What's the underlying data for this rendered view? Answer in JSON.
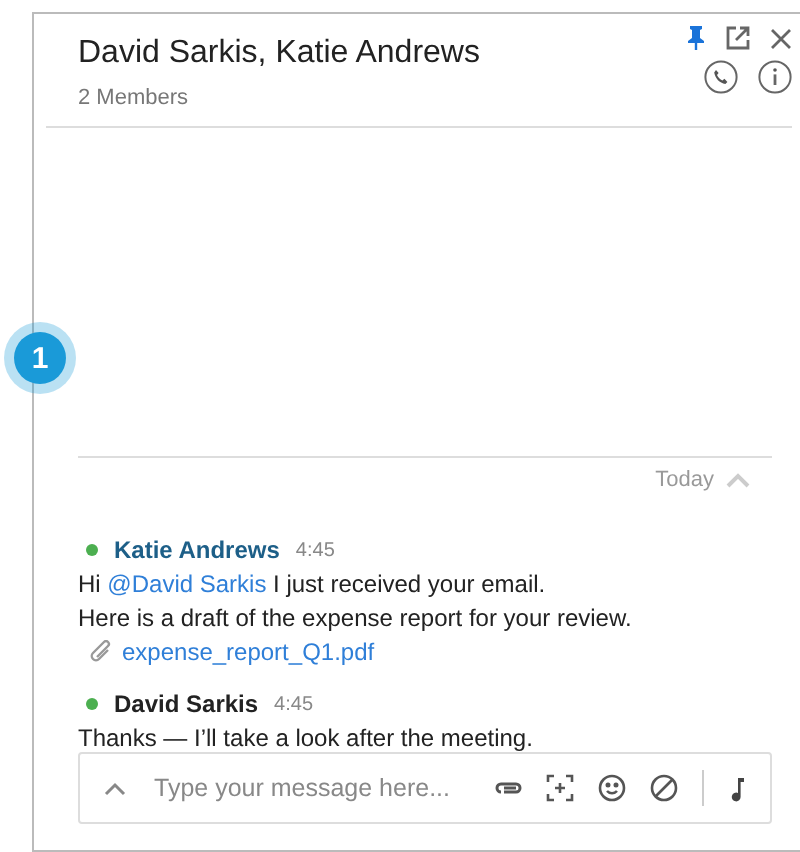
{
  "header": {
    "title": "David Sarkis, Katie Andrews",
    "subtitle": "2 Members",
    "pinned": true
  },
  "step_badge": "1",
  "day_divider": {
    "label": "Today",
    "expanded": true
  },
  "messages": [
    {
      "author": "Katie Andrews",
      "time": "4:45",
      "online": true,
      "highlight": true,
      "lines": [
        [
          {
            "kind": "plain",
            "text": "Hi "
          },
          {
            "kind": "mention",
            "text": "@David Sarkis"
          },
          {
            "kind": "plain",
            "text": " I just received your email."
          }
        ],
        [
          {
            "kind": "plain",
            "text": "Here is a draft of the expense report for your review."
          }
        ]
      ],
      "attachment": "expense_report_Q1.pdf"
    },
    {
      "author": "David Sarkis",
      "time": "4:45",
      "online": true,
      "highlight": false,
      "lines": [
        [
          {
            "kind": "plain",
            "text": "Thanks — I’ll take a look after the meeting."
          }
        ]
      ]
    }
  ],
  "composer": {
    "placeholder": "Type your message here..."
  }
}
